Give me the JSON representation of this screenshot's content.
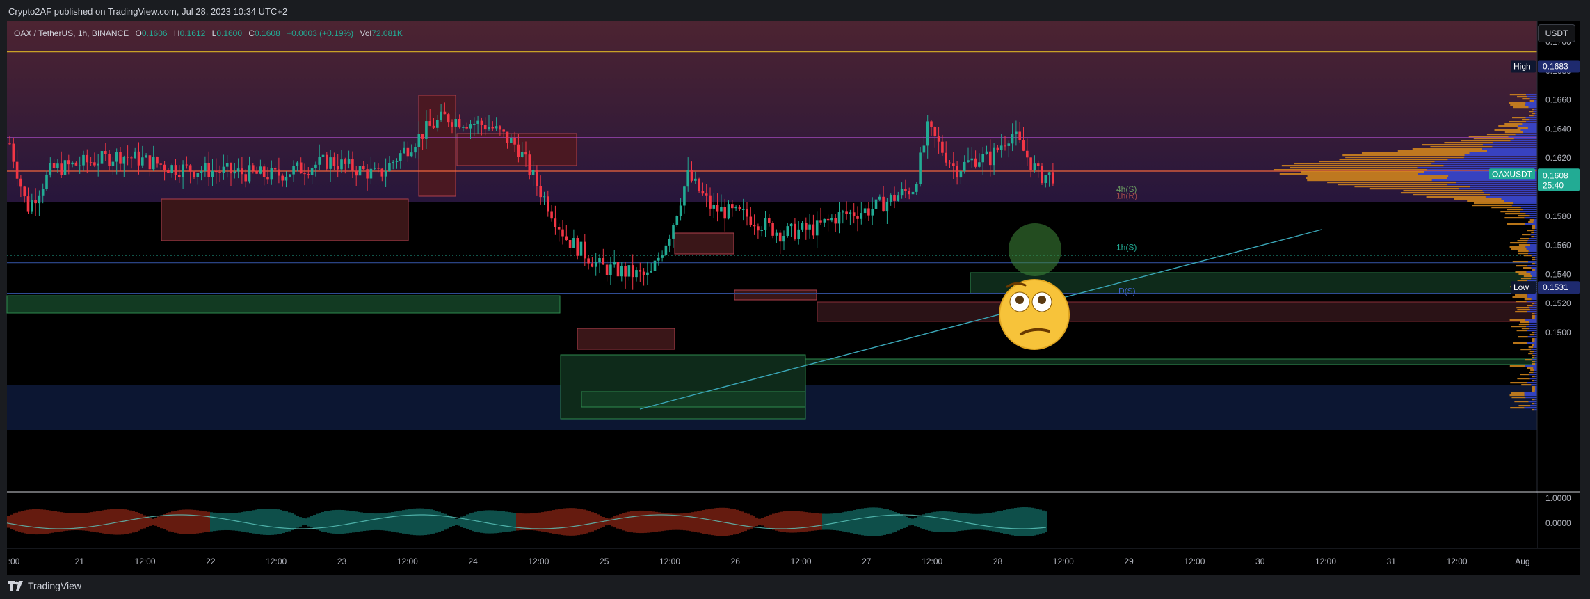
{
  "header": {
    "publisher_line": "Crypto2AF published on TradingView.com, Jul 28, 2023 10:34 UTC+2"
  },
  "legend": {
    "symbol": "OAX / TetherUS, 1h, BINANCE",
    "o_label": "O",
    "o_value": "0.1606",
    "h_label": "H",
    "h_value": "0.1612",
    "l_label": "L",
    "l_value": "0.1600",
    "c_label": "C",
    "c_value": "0.1608",
    "change": "+0.0003 (+0.19%)",
    "vol_label": "Vol",
    "vol_value": "72.081K"
  },
  "currency": "USDT",
  "footer": {
    "brand": "TradingView"
  },
  "chart_data": {
    "type": "candlestick",
    "symbol": "OAXUSDT",
    "timeframe": "1h",
    "x_ticks": [
      ":00",
      "21",
      "12:00",
      "22",
      "12:00",
      "23",
      "12:00",
      "24",
      "12:00",
      "25",
      "12:00",
      "26",
      "12:00",
      "27",
      "12:00",
      "28",
      "12:00",
      "29",
      "12:00",
      "30",
      "12:00",
      "31",
      "12:00",
      "Aug"
    ],
    "y_ticks": [
      "0.1700",
      "0.1680",
      "0.1660",
      "0.1640",
      "0.1620",
      "0.1600",
      "0.1580",
      "0.1560",
      "0.1540",
      "0.1520",
      "0.1500"
    ],
    "y_values": [
      0.17,
      0.168,
      0.166,
      0.164,
      0.162,
      0.16,
      0.158,
      0.156,
      0.154,
      0.152,
      0.15
    ],
    "ylim": [
      0.1495,
      0.1715
    ],
    "price_labels": [
      {
        "name": "High",
        "value": "0.1683",
        "price": 0.1683,
        "color": "#1e2a6e"
      },
      {
        "name": "OAXUSDT",
        "value": "0.1608",
        "extra": "25:40",
        "price": 0.1608,
        "color": "#22ab94"
      },
      {
        "name": "Low",
        "value": "0.1531",
        "price": 0.1531,
        "color": "#1e2a6e"
      }
    ],
    "zone_labels": [
      {
        "text": "4h(S)",
        "price": 0.15985,
        "color": "#6a9a60"
      },
      {
        "text": "1h(R)",
        "price": 0.1594,
        "color": "#a04a4a"
      },
      {
        "text": "1h(S)",
        "price": 0.15585,
        "color": "#22ab94"
      },
      {
        "text": "D(S)",
        "price": 0.15285,
        "color": "#3f5ec7"
      }
    ],
    "lines": [
      {
        "price": 0.1693,
        "color": "#c9a227"
      },
      {
        "price": 0.1634,
        "color": "#b34fd1"
      },
      {
        "price": 0.1611,
        "color": "#f0643c"
      },
      {
        "price": 0.1548,
        "color": "#2f4c94"
      },
      {
        "price": 0.1527,
        "color": "#2f4c94"
      }
    ],
    "oscillator_ticks": [
      "1.0000",
      "0.0000"
    ],
    "colors": {
      "up": "#22ab94",
      "down": "#f23645",
      "background": "#000000"
    }
  }
}
